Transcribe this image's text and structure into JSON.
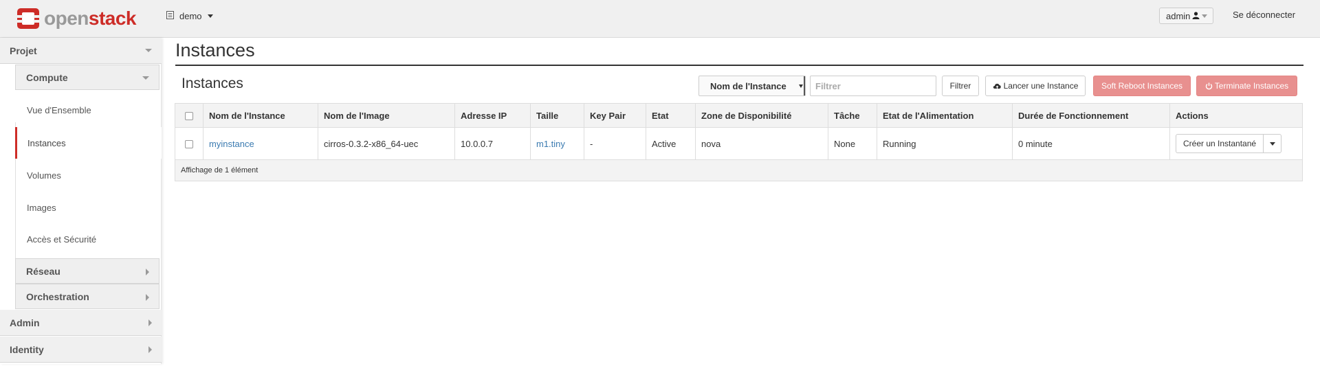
{
  "navbar": {
    "brand_open": "open",
    "brand_stack": "stack",
    "logo_icon": "openstack-logo-icon",
    "project": "demo",
    "user": "admin",
    "logout": "Se déconnecter"
  },
  "sidebar": {
    "projet": "Projet",
    "compute": "Compute",
    "links": {
      "overview": "Vue d'Ensemble",
      "instances": "Instances",
      "volumes": "Volumes",
      "images": "Images",
      "security": "Accès et Sécurité"
    },
    "reseau": "Réseau",
    "orchestration": "Orchestration",
    "admin": "Admin",
    "identity": "Identity"
  },
  "page": {
    "title": "Instances"
  },
  "table": {
    "title": "Instances",
    "filter_select": "Nom de l'Instance",
    "filter_placeholder": "Filtrer",
    "filter_button": "Filtrer",
    "launch_button": "Lancer une Instance",
    "reboot_button": "Soft Reboot Instances",
    "terminate_button": "Terminate Instances",
    "columns": [
      "Nom de l'Instance",
      "Nom de l'Image",
      "Adresse IP",
      "Taille",
      "Key Pair",
      "Etat",
      "Zone de Disponibilité",
      "Tâche",
      "Etat de l'Alimentation",
      "Durée de Fonctionnement",
      "Actions"
    ],
    "rows": [
      {
        "name": "myinstance",
        "image": "cirros-0.3.2-x86_64-uec",
        "ip": "10.0.0.7",
        "size": "m1.tiny",
        "keypair": "-",
        "status": "Active",
        "zone": "nova",
        "task": "None",
        "power": "Running",
        "uptime": "0 minute",
        "action": "Créer un Instantané"
      }
    ],
    "footer": "Affichage de 1 élément"
  },
  "colors": {
    "brand_red": "#cd2c27",
    "brand_grey": "#999999",
    "danger_button": "#e8908f",
    "link": "#3a7ab0"
  }
}
